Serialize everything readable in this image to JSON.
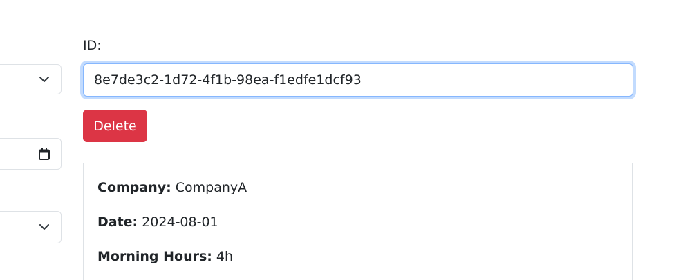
{
  "form": {
    "id_label": "ID:",
    "id_value": "8e7de3c2-1d72-4f1b-98ea-f1edfe1dcf93",
    "delete_label": "Delete"
  },
  "details": {
    "company_key": "Company:",
    "company_value": "CompanyA",
    "date_key": "Date:",
    "date_value": "2024-08-01",
    "morning_key": "Morning Hours:",
    "morning_value": "4h"
  },
  "icons": {
    "select_1": "chevron-down-icon",
    "date": "calendar-icon",
    "select_2": "chevron-down-icon"
  },
  "colors": {
    "danger": "#dc3545",
    "focus_border": "#86b7fe",
    "border": "#dee2e6",
    "text": "#212529"
  }
}
